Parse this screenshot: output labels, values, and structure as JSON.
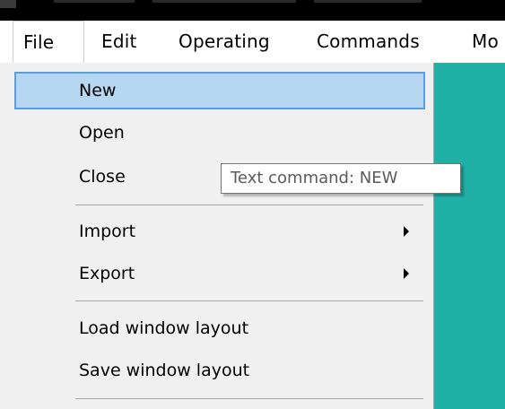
{
  "menubar": {
    "items": [
      {
        "label": "File",
        "active": true
      },
      {
        "label": "Edit"
      },
      {
        "label": "Operating"
      },
      {
        "label": "Commands"
      },
      {
        "label": "Mo"
      }
    ]
  },
  "file_menu": {
    "items": [
      {
        "label": "New",
        "highlighted": true
      },
      {
        "label": "Open"
      },
      {
        "label": "Close"
      },
      {
        "label": "Import",
        "submenu": true
      },
      {
        "label": "Export",
        "submenu": true
      },
      {
        "label": "Load window layout"
      },
      {
        "label": "Save window layout"
      }
    ]
  },
  "tooltip": {
    "text": "Text command: NEW"
  },
  "colors": {
    "highlight_fill": "#b6d7f2",
    "highlight_border": "#5d9ed8",
    "workspace_teal": "#20b0a6",
    "menu_background": "#f0f0f0"
  }
}
